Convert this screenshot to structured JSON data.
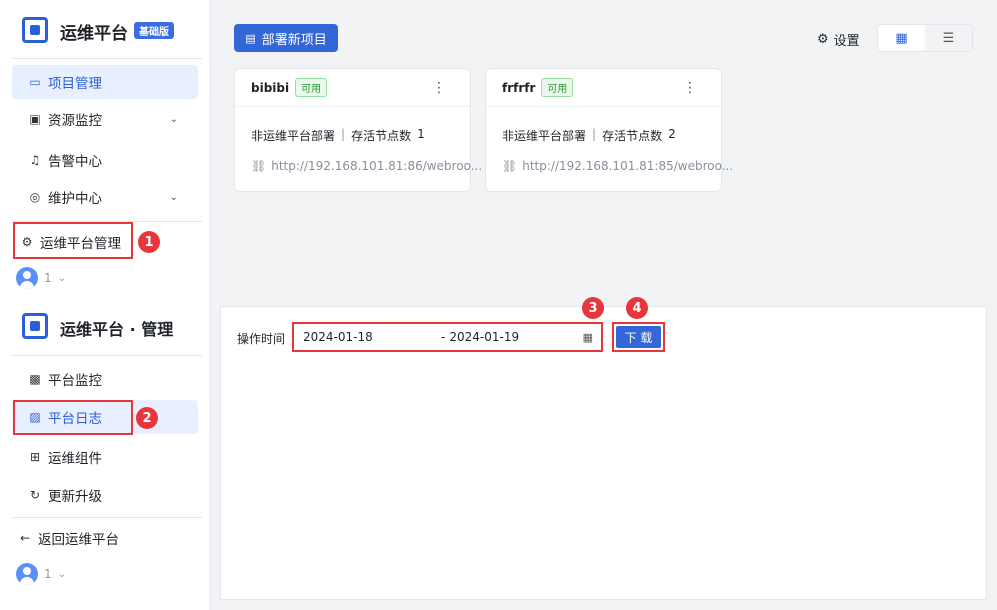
{
  "top_sidebar": {
    "brand": "运维平台",
    "edition": "基础版",
    "menu": [
      {
        "label": "项目管理",
        "icon": "project-icon",
        "active": true
      },
      {
        "label": "资源监控",
        "icon": "monitor-icon",
        "chevron": true
      },
      {
        "label": "告警中心",
        "icon": "bell-icon"
      },
      {
        "label": "维护中心",
        "icon": "maintenance-icon",
        "chevron": true
      }
    ],
    "admin_label": "运维平台管理",
    "user": "1"
  },
  "toolbar": {
    "deploy_label": "部署新项目",
    "settings_label": "设置"
  },
  "projects": [
    {
      "name": "bibibi",
      "status": "可用",
      "deploy_type": "非运维平台部署",
      "separator": "|",
      "nodes_label": "存活节点数",
      "nodes": "1",
      "url": "http://192.168.101.81:86/webroo..."
    },
    {
      "name": "frfrfr",
      "status": "可用",
      "deploy_type": "非运维平台部署",
      "separator": "|",
      "nodes_label": "存活节点数",
      "nodes": "2",
      "url": "http://192.168.101.81:85/webroo..."
    }
  ],
  "admin_sidebar": {
    "brand": "运维平台 · 管理",
    "menu": [
      {
        "label": "平台监控",
        "icon": "platform-monitor-icon"
      },
      {
        "label": "平台日志",
        "icon": "log-icon",
        "active": true
      },
      {
        "label": "运维组件",
        "icon": "components-icon"
      },
      {
        "label": "更新升级",
        "icon": "update-icon"
      }
    ],
    "back_label": "返回运维平台",
    "user": "1"
  },
  "log_panel": {
    "time_label": "操作时间",
    "start_date": "2024-01-18",
    "range_sep": "-",
    "end_date": "2024-01-19",
    "download_label": "下 载"
  },
  "callouts": [
    "1",
    "2",
    "3",
    "4"
  ]
}
